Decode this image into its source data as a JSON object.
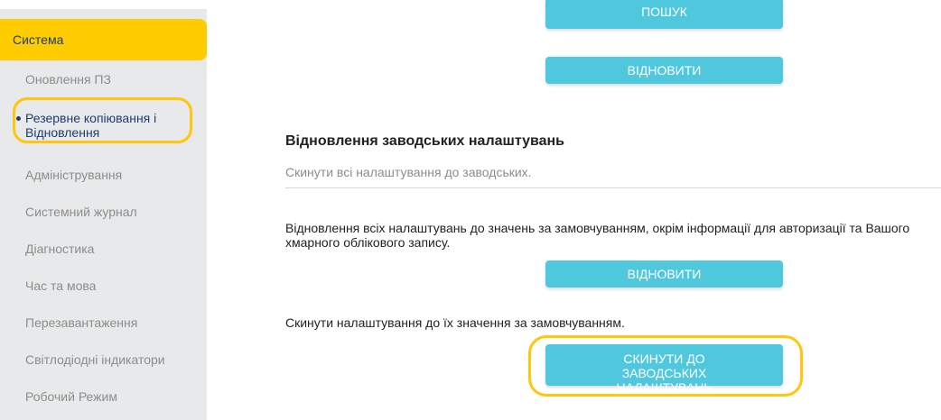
{
  "sidebar": {
    "header": "Система",
    "items": [
      {
        "label": "Оновлення ПЗ"
      },
      {
        "label": "Резервне копіювання і Відновлення"
      },
      {
        "label": "Адміністрування"
      },
      {
        "label": "Системний журнал"
      },
      {
        "label": "Діагностика"
      },
      {
        "label": "Час та мова"
      },
      {
        "label": "Перезавантаження"
      },
      {
        "label": "Світлодіодні індикатори"
      },
      {
        "label": "Робочий Режим"
      }
    ]
  },
  "main": {
    "search_button": "ПОШУК",
    "restore_button_top": "ВІДНОВИТИ",
    "factory": {
      "title": "Відновлення заводських налаштувань",
      "subtitle": "Скинути всі налаштування до заводських.",
      "restore_desc": "Відновлення всіх налаштувань до значень за замовчуванням, окрім інформації для авторизації та Вашого хмарного облікового запису.",
      "restore_button": "ВІДНОВИТИ",
      "reset_desc": "Скинути налаштування до їх значення за замовчуванням.",
      "reset_button": "СКИНУТИ ДО ЗАВОДСЬКИХ НАЛАШТУВАНЬ"
    }
  },
  "colors": {
    "accent": "#4fc8de",
    "sidebar_header": "#ffcc00",
    "highlight": "#ffc60b"
  }
}
